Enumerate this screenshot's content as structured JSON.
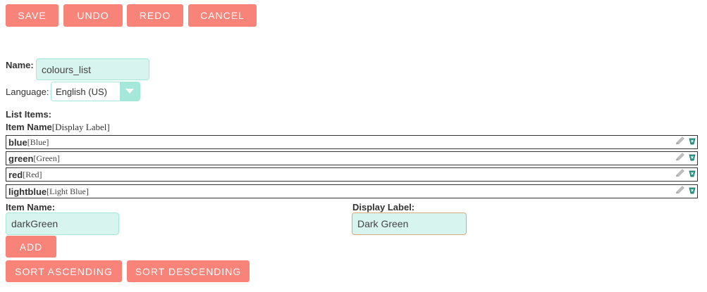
{
  "toolbar": {
    "save": "SAVE",
    "undo": "UNDO",
    "redo": "REDO",
    "cancel": "CANCEL"
  },
  "form": {
    "name_label": "Name:",
    "name_value": "colours_list",
    "language_label": "Language:",
    "language_value": "English (US)",
    "list_items_label": "List Items:",
    "header_item_name": "Item Name",
    "header_display_label": "[Display Label]"
  },
  "list_items": [
    {
      "name": "blue",
      "label": "[Blue]"
    },
    {
      "name": "green",
      "label": "[Green]"
    },
    {
      "name": "red",
      "label": "[Red]"
    },
    {
      "name": "lightblue",
      "label": "[Light Blue]"
    }
  ],
  "new_item": {
    "item_name_label": "Item Name:",
    "item_name_value": "darkGreen",
    "display_label_label": "Display Label:",
    "display_label_value": "Dark Green",
    "add": "ADD",
    "sort_ascending": "SORT ASCENDING",
    "sort_descending": "SORT DESCENDING"
  },
  "icons": {
    "edit": "pencil-icon",
    "delete": "delete-icon",
    "dropdown": "chevron-down-icon"
  },
  "colors": {
    "button": "#f88379",
    "input_bg": "#d8f4ef",
    "input_border": "#a5e8d9"
  }
}
